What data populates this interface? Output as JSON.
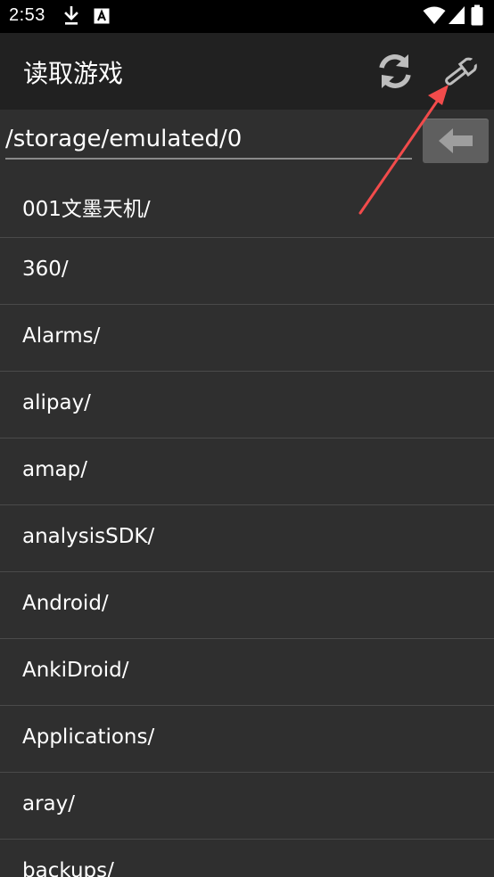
{
  "status_bar": {
    "time": "2:53",
    "icons": [
      "download-icon",
      "a-notification-icon",
      "wifi-icon",
      "signal-icon",
      "battery-icon"
    ]
  },
  "app_bar": {
    "title": "读取游戏",
    "actions": [
      {
        "name": "refresh-icon"
      },
      {
        "name": "wrench-icon"
      }
    ]
  },
  "path_bar": {
    "path": "/storage/emulated/0",
    "back_icon": "back-arrow-icon"
  },
  "files": [
    "001文墨天机/",
    "360/",
    "Alarms/",
    "alipay/",
    "amap/",
    "analysisSDK/",
    "Android/",
    "AnkiDroid/",
    "Applications/",
    "aray/",
    "backups/"
  ],
  "colors": {
    "background": "#2f2f2f",
    "app_bar": "#212121",
    "status_bar": "#000000",
    "divider": "#4a4a4a",
    "annotation_arrow": "#f24b4b"
  }
}
